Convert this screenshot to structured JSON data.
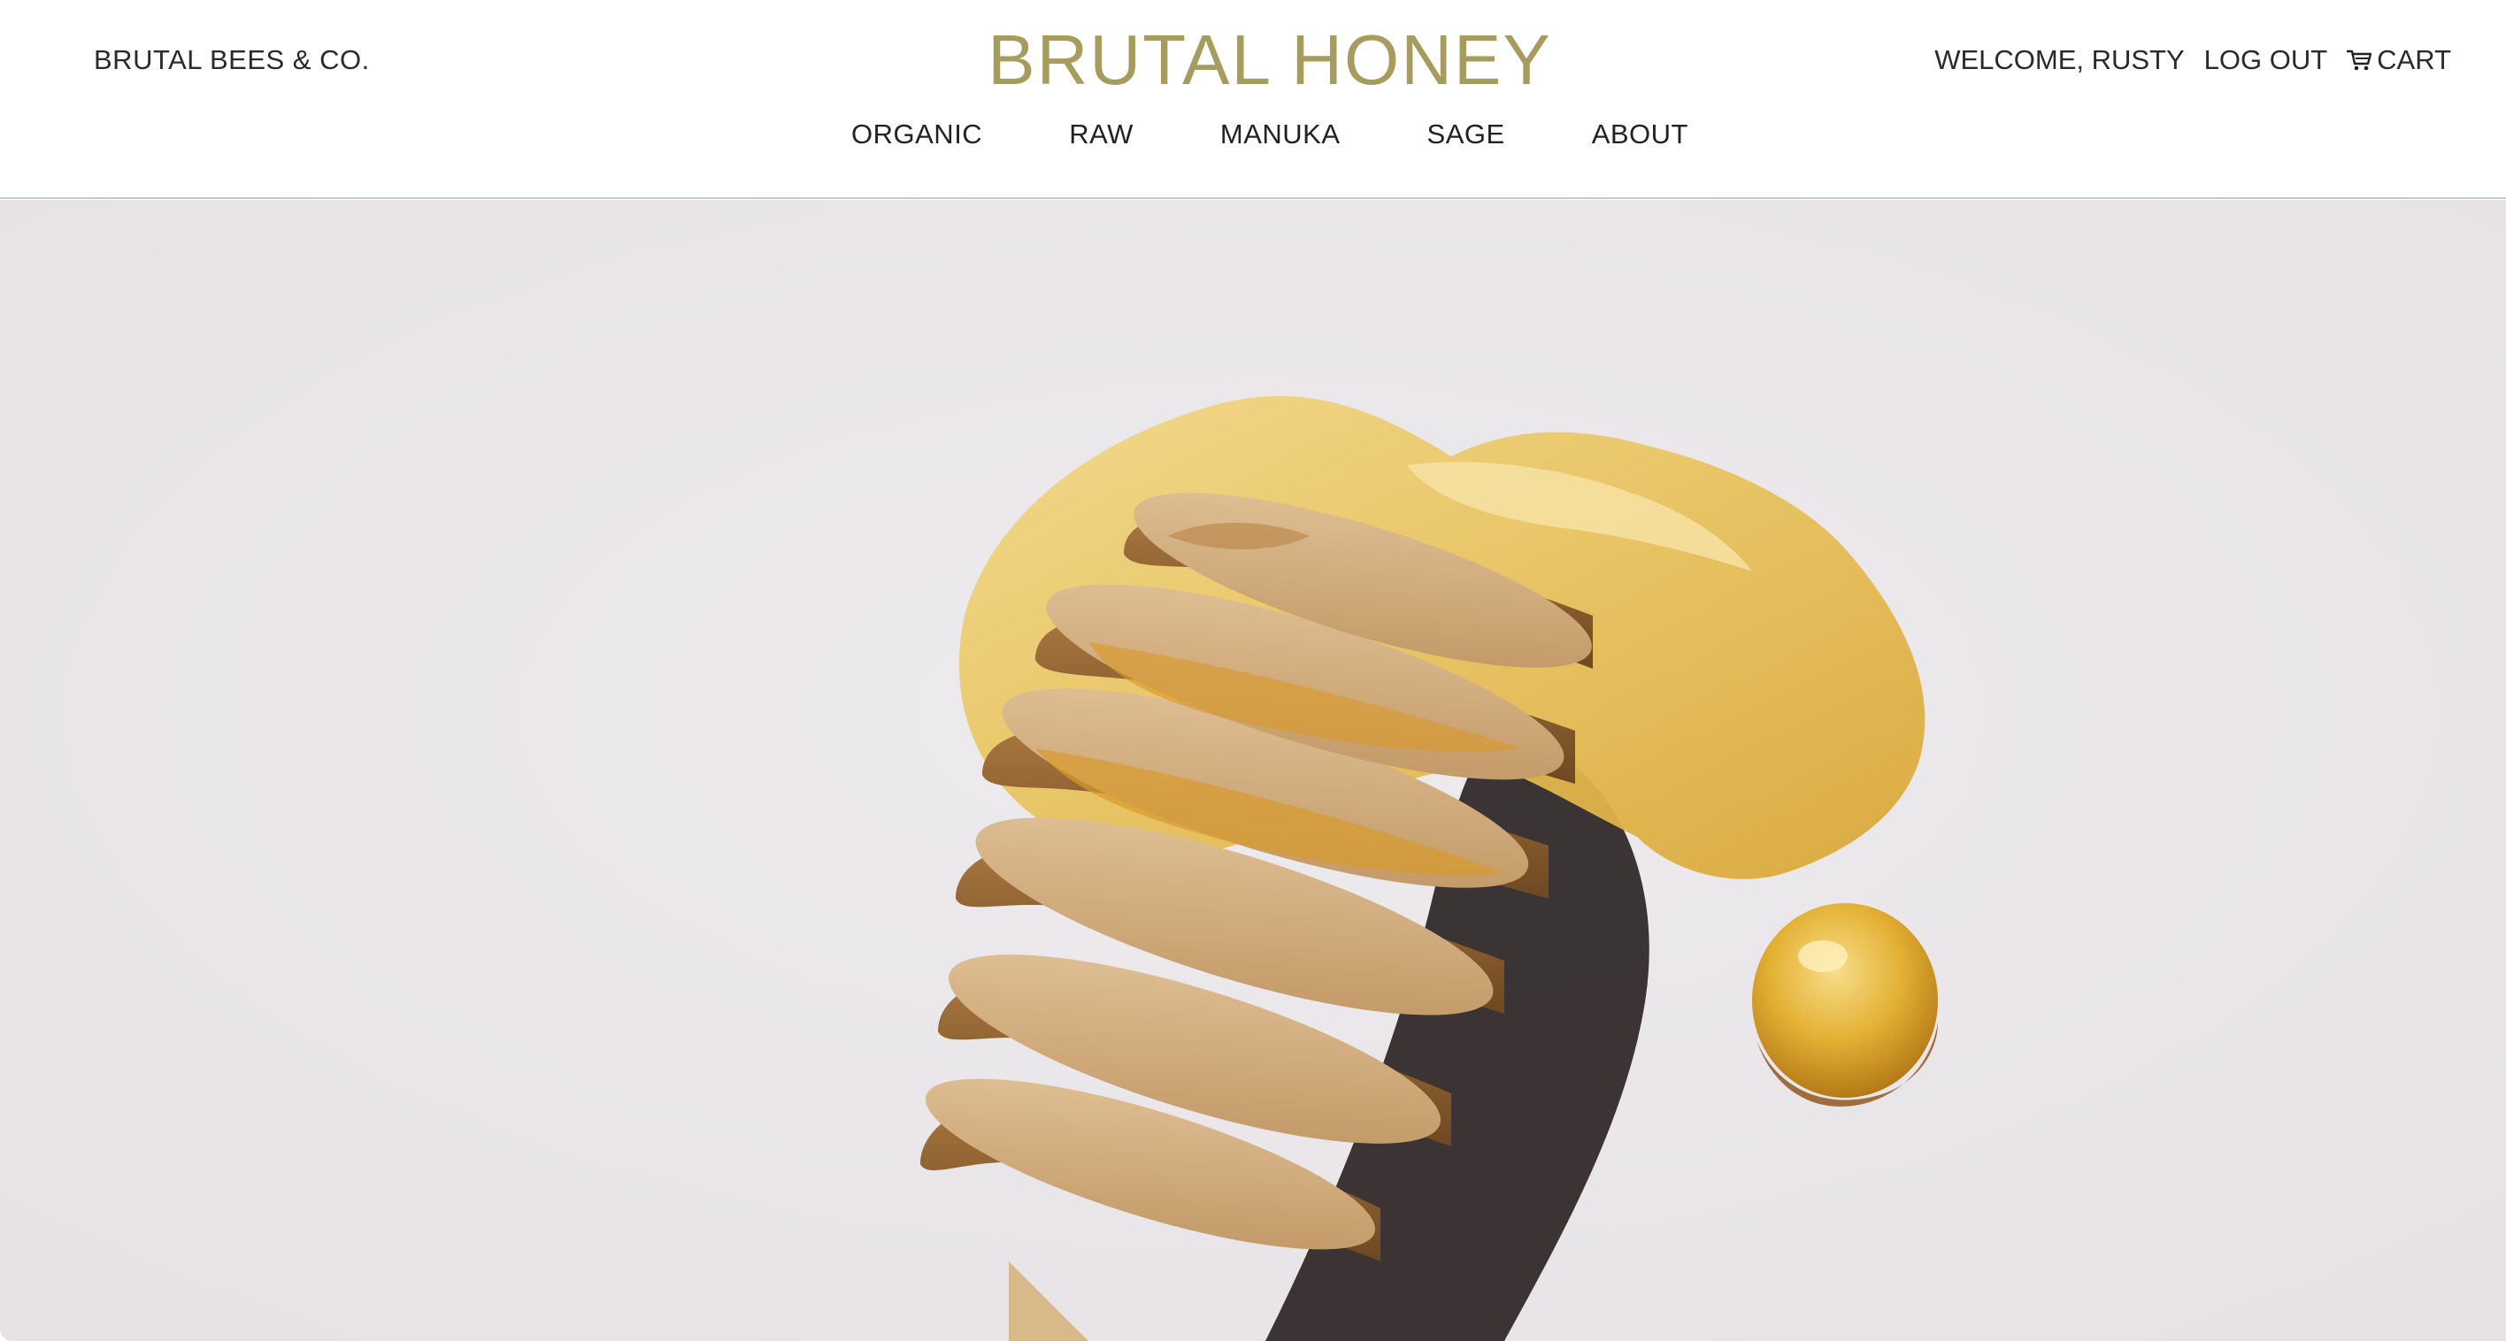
{
  "header": {
    "company": "BRUTAL BEES & CO.",
    "brand": "BRUTAL HONEY",
    "welcome": "WELCOME, RUSTY",
    "logout": "LOG OUT",
    "cart": "CART"
  },
  "nav": {
    "items": [
      {
        "label": "ORGANIC"
      },
      {
        "label": "RAW"
      },
      {
        "label": "MANUKA"
      },
      {
        "label": "SAGE"
      },
      {
        "label": "ABOUT"
      }
    ]
  },
  "colors": {
    "brand": "#a69c5e",
    "hero_background": "#ebe8ec",
    "honey": "#e2b23a",
    "wood": "#c79a63"
  },
  "hero": {
    "icon": "honey-dipper-image"
  }
}
